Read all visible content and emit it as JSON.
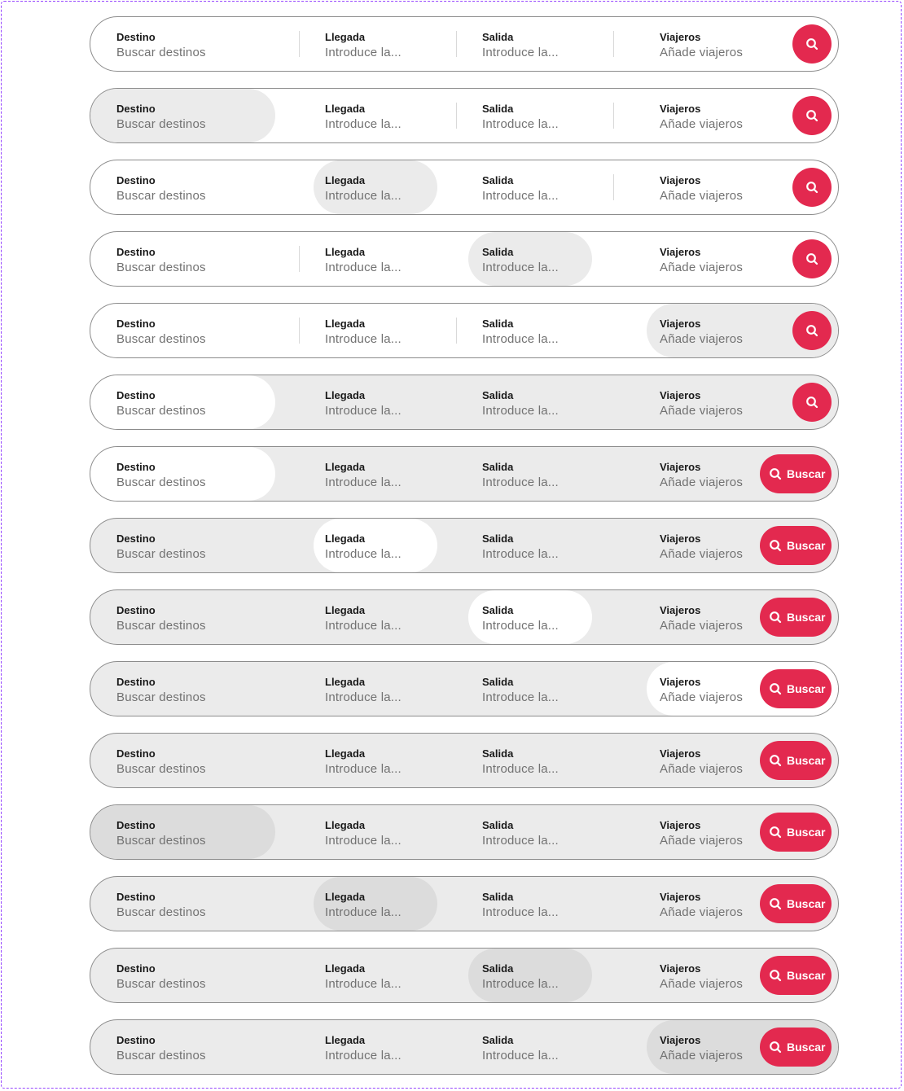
{
  "fields": {
    "destino": {
      "label": "Destino",
      "placeholder": "Buscar destinos"
    },
    "llegada": {
      "label": "Llegada",
      "placeholder": "Introduce la..."
    },
    "salida": {
      "label": "Salida",
      "placeholder": "Introduce la..."
    },
    "viajeros": {
      "label": "Viajeros",
      "placeholder": "Añade viajeros"
    }
  },
  "search_button": {
    "label": "Buscar",
    "icon": "search-icon"
  },
  "colors": {
    "accent": "#e3294f",
    "border": "#8c8c8c",
    "field_active": "#ebebeb",
    "field_pressed": "#dcdcdc",
    "separator": "#d9d9d9",
    "frame": "#9747ff"
  },
  "variants": [
    {
      "background": "white",
      "highlight": "none",
      "highlight_color": "none",
      "button": "icon",
      "separators": [
        true,
        true,
        true
      ]
    },
    {
      "background": "white",
      "highlight": "destino",
      "highlight_color": "grey",
      "button": "icon",
      "separators": [
        false,
        true,
        true
      ]
    },
    {
      "background": "white",
      "highlight": "llegada",
      "highlight_color": "grey",
      "button": "icon",
      "separators": [
        false,
        false,
        true
      ]
    },
    {
      "background": "white",
      "highlight": "salida",
      "highlight_color": "grey",
      "button": "icon",
      "separators": [
        true,
        false,
        false
      ]
    },
    {
      "background": "white",
      "highlight": "viajeros",
      "highlight_color": "grey",
      "button": "icon",
      "separators": [
        true,
        true,
        false
      ]
    },
    {
      "background": "grey",
      "highlight": "destino",
      "highlight_color": "white",
      "button": "icon",
      "separators": [
        false,
        false,
        false
      ]
    },
    {
      "background": "grey",
      "highlight": "destino",
      "highlight_color": "white",
      "button": "text",
      "separators": [
        false,
        false,
        false
      ]
    },
    {
      "background": "grey",
      "highlight": "llegada",
      "highlight_color": "white",
      "button": "text",
      "separators": [
        false,
        false,
        false
      ]
    },
    {
      "background": "grey",
      "highlight": "salida",
      "highlight_color": "white",
      "button": "text",
      "separators": [
        false,
        false,
        false
      ]
    },
    {
      "background": "grey",
      "highlight": "viajeros",
      "highlight_color": "white",
      "button": "text",
      "separators": [
        false,
        false,
        false
      ]
    },
    {
      "background": "grey",
      "highlight": "none",
      "highlight_color": "none",
      "button": "text",
      "separators": [
        false,
        false,
        false
      ]
    },
    {
      "background": "grey",
      "highlight": "destino",
      "highlight_color": "dark",
      "button": "text",
      "separators": [
        false,
        false,
        false
      ]
    },
    {
      "background": "grey",
      "highlight": "llegada",
      "highlight_color": "dark",
      "button": "text",
      "separators": [
        false,
        false,
        false
      ]
    },
    {
      "background": "grey",
      "highlight": "salida",
      "highlight_color": "dark",
      "button": "text",
      "separators": [
        false,
        false,
        false
      ]
    },
    {
      "background": "grey",
      "highlight": "viajeros",
      "highlight_color": "dark",
      "button": "text",
      "separators": [
        false,
        false,
        false
      ]
    }
  ]
}
